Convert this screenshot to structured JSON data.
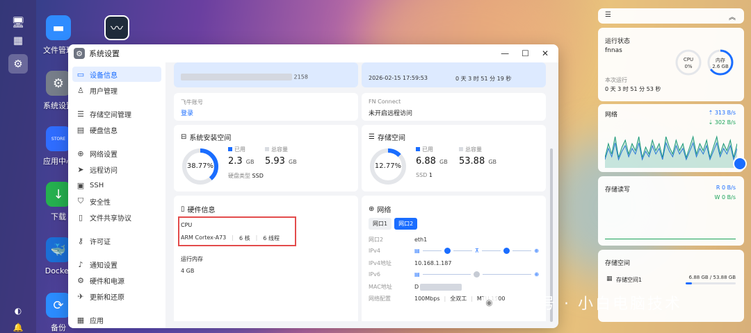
{
  "desktop": {
    "icons": [
      {
        "label": "文件管理",
        "icon": "folder-icon",
        "color": "#2f8cff"
      },
      {
        "label": "系统设置",
        "icon": "gear-icon",
        "color": "#777e8a"
      },
      {
        "label": "应用中心",
        "icon": "store-icon",
        "color": "#2f6dff"
      },
      {
        "label": "下载",
        "icon": "download-icon",
        "color": "#25b04f"
      },
      {
        "label": "Docker",
        "icon": "docker-icon",
        "color": "#1b6fd6"
      },
      {
        "label": "备份",
        "icon": "backup-icon",
        "color": "#2b8cff"
      },
      {
        "label": "",
        "icon": "monitor-app-icon",
        "color": "#1f2b3b"
      }
    ],
    "store_text": "STORE"
  },
  "window": {
    "title": "系统设置",
    "minimize": "—",
    "maximize": "☐",
    "close": "✕"
  },
  "sidebar": {
    "items": [
      {
        "label": "设备信息",
        "icon": "monitor-icon",
        "active": true
      },
      {
        "label": "用户管理",
        "icon": "user-icon"
      },
      {
        "label": "存储空间管理",
        "icon": "storage-icon"
      },
      {
        "label": "硬盘信息",
        "icon": "disk-icon"
      },
      {
        "label": "网络设置",
        "icon": "network-icon"
      },
      {
        "label": "远程访问",
        "icon": "send-icon"
      },
      {
        "label": "SSH",
        "icon": "terminal-icon"
      },
      {
        "label": "安全性",
        "icon": "shield-icon"
      },
      {
        "label": "文件共享协议",
        "icon": "file-share-icon"
      },
      {
        "label": "许可证",
        "icon": "key-icon"
      },
      {
        "label": "通知设置",
        "icon": "bell-icon"
      },
      {
        "label": "硬件和电源",
        "icon": "power-icon"
      },
      {
        "label": "更新和还原",
        "icon": "update-icon"
      },
      {
        "label": "应用",
        "icon": "apps-icon"
      }
    ]
  },
  "device": {
    "serial_tail": "2158",
    "time": "2026-02-15 17:59:53",
    "uptime": "0 天 3 时 51 分 19 秒",
    "account_label": "飞牛账号",
    "account_action": "登录",
    "fnconnect_label": "FN Connect",
    "fnconnect_value": "未开启远程访问"
  },
  "system_space": {
    "title": "系统安装空间",
    "percent": "38.77%",
    "percent_value": 38.77,
    "used_label": "已用",
    "used": "2.3",
    "used_unit": "GB",
    "total_label": "总容量",
    "total": "5.93",
    "total_unit": "GB",
    "disk_type_label": "硬盘类型",
    "disk_type": "SSD"
  },
  "storage_space": {
    "title": "存储空间",
    "percent": "12.77%",
    "percent_value": 12.77,
    "used_label": "已用",
    "used": "6.88",
    "used_unit": "GB",
    "total_label": "总容量",
    "total": "53.88",
    "total_unit": "GB",
    "ssd_label": "SSD",
    "ssd_count": "1"
  },
  "hardware": {
    "title": "硬件信息",
    "cpu_label": "CPU",
    "cpu_model": "ARM Cortex-A73",
    "cores": "6 核",
    "threads": "6 线程",
    "ram_label": "运行内存",
    "ram_value": "4 GB"
  },
  "network": {
    "title": "网络",
    "tabs": [
      "网口1",
      "网口2"
    ],
    "active_tab": 1,
    "rows": [
      {
        "k": "网口2",
        "v": "eth1"
      },
      {
        "k": "IPv4",
        "v": ""
      },
      {
        "k": "IPv4地址",
        "v": "10.168.1.187"
      },
      {
        "k": "IPv6",
        "v": ""
      },
      {
        "k": "MAC地址",
        "v": "D"
      },
      {
        "k": "网络配置",
        "v": "100Mbps"
      }
    ],
    "duplex": "全双工",
    "mtu": "MTU 1500"
  },
  "widgets": {
    "status": {
      "title": "运行状态",
      "host": "fnnas",
      "cpu_label": "CPU",
      "cpu_value": "0%",
      "cpu_percent": 0,
      "mem_label": "内存",
      "mem_value": "2.6 GB",
      "mem_percent": 65,
      "uptime_label": "本次运行",
      "uptime": "0 天 3 时 51 分 53 秒"
    },
    "net": {
      "title": "网络",
      "up": "313 B/s",
      "down": "302 B/s",
      "samples": [
        3,
        7,
        4,
        9,
        3,
        6,
        8,
        4,
        7,
        5,
        9,
        3,
        6,
        4,
        8,
        5,
        7,
        3,
        9,
        6,
        4,
        8,
        5,
        7,
        3,
        6,
        9,
        4,
        7,
        5,
        8,
        3,
        6,
        9,
        4,
        7,
        5,
        8,
        3,
        7
      ]
    },
    "disk_io": {
      "title": "存储读写",
      "read_label": "R",
      "read": "0 B/s",
      "write_label": "W",
      "write": "0 B/s"
    },
    "storage": {
      "title": "存储空间",
      "name": "存储空间1",
      "usage": "6.88 GB / 53.88 GB",
      "fraction": 0.1277
    }
  },
  "watermark": "公众号 · 小白电脑技术",
  "colors": {
    "accent": "#1a6dff",
    "green": "#1aa35a",
    "ring_bg": "#e4e6ea"
  }
}
